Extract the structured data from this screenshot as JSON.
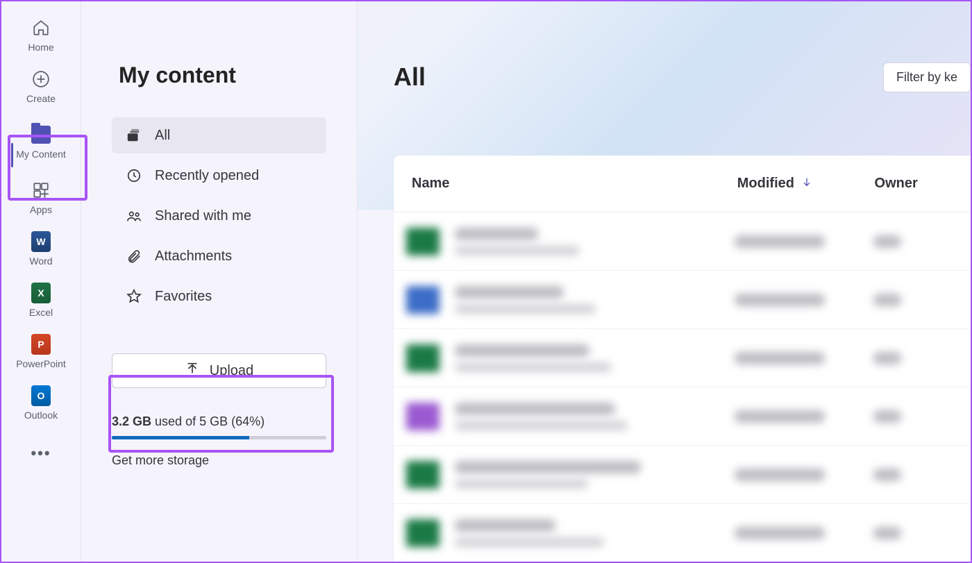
{
  "rail": {
    "items": [
      {
        "label": "Home"
      },
      {
        "label": "Create"
      },
      {
        "label": "My Content"
      },
      {
        "label": "Apps"
      },
      {
        "label": "Word"
      },
      {
        "label": "Excel"
      },
      {
        "label": "PowerPoint"
      },
      {
        "label": "Outlook"
      }
    ]
  },
  "sidebar": {
    "title": "My content",
    "nav": [
      {
        "label": "All"
      },
      {
        "label": "Recently opened"
      },
      {
        "label": "Shared with me"
      },
      {
        "label": "Attachments"
      },
      {
        "label": "Favorites"
      }
    ],
    "upload_label": "Upload",
    "storage": {
      "used": "3.2 GB",
      "total": "5 GB",
      "percent": 64,
      "text_used": " used of ",
      "text_percent": "(64%)",
      "link": "Get more storage"
    }
  },
  "main": {
    "heading": "All",
    "filter_label": "Filter by ke",
    "columns": {
      "name": "Name",
      "modified": "Modified",
      "owner": "Owner"
    },
    "rows": [
      {
        "icon_color": "#1a7a45"
      },
      {
        "icon_color": "#3b6cc7"
      },
      {
        "icon_color": "#1a7a45"
      },
      {
        "icon_color": "#9b5ad1"
      },
      {
        "icon_color": "#1a7a45"
      },
      {
        "icon_color": "#1a7a45"
      }
    ]
  }
}
